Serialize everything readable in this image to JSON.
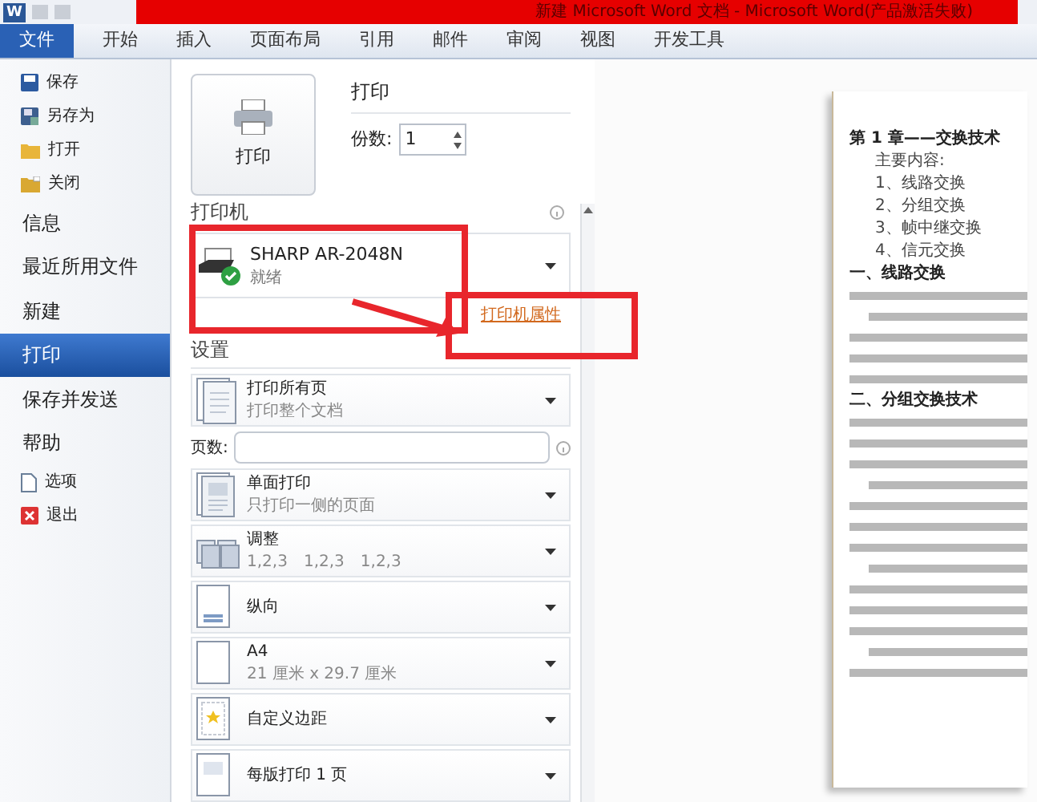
{
  "window": {
    "app_icon_letter": "W",
    "title": "新建 Microsoft Word 文档 - Microsoft Word(产品激活失败)"
  },
  "ribbon_tabs": [
    {
      "label": "文件",
      "selected": true
    },
    {
      "label": "开始",
      "selected": false
    },
    {
      "label": "插入",
      "selected": false
    },
    {
      "label": "页面布局",
      "selected": false
    },
    {
      "label": "引用",
      "selected": false
    },
    {
      "label": "邮件",
      "selected": false
    },
    {
      "label": "审阅",
      "selected": false
    },
    {
      "label": "视图",
      "selected": false
    },
    {
      "label": "开发工具",
      "selected": false
    }
  ],
  "sidebar": {
    "items": [
      {
        "label": "保存",
        "kind": "command",
        "selected": false
      },
      {
        "label": "另存为",
        "kind": "command",
        "selected": false
      },
      {
        "label": "打开",
        "kind": "command",
        "selected": false
      },
      {
        "label": "关闭",
        "kind": "command",
        "selected": false
      },
      {
        "label": "信息",
        "kind": "page",
        "selected": false
      },
      {
        "label": "最近所用文件",
        "kind": "page",
        "selected": false
      },
      {
        "label": "新建",
        "kind": "page",
        "selected": false
      },
      {
        "label": "打印",
        "kind": "page",
        "selected": true
      },
      {
        "label": "保存并发送",
        "kind": "page",
        "selected": false
      },
      {
        "label": "帮助",
        "kind": "page",
        "selected": false
      },
      {
        "label": "选项",
        "kind": "command",
        "selected": false
      },
      {
        "label": "退出",
        "kind": "command",
        "selected": false
      }
    ]
  },
  "print": {
    "button": "打印",
    "heading": "打印",
    "copies_label": "份数:",
    "copies_value": "1"
  },
  "printer": {
    "heading": "打印机",
    "name": "SHARP AR-2048N",
    "status": "就绪",
    "properties_link": "打印机属性"
  },
  "settings": {
    "heading": "设置",
    "items": [
      {
        "kind": "pages",
        "title": "打印所有页",
        "subtitle": "打印整个文档"
      },
      {
        "kind": "page_range",
        "label": "页数:"
      },
      {
        "kind": "duplex",
        "title": "单面打印",
        "subtitle": "只打印一侧的页面"
      },
      {
        "kind": "collate",
        "title": "调整",
        "subtitle_parts": [
          "1,2,3",
          "1,2,3",
          "1,2,3"
        ]
      },
      {
        "kind": "orientation",
        "title": "纵向"
      },
      {
        "kind": "paper",
        "title": "A4",
        "subtitle": "21 厘米 x 29.7 厘米"
      },
      {
        "kind": "margins",
        "title": "自定义边距"
      },
      {
        "kind": "per_sheet",
        "title": "每版打印 1 页"
      }
    ]
  },
  "preview": {
    "lines": [
      {
        "kind": "heading",
        "text": "第 1 章——交换技术"
      },
      {
        "kind": "indent",
        "text": "主要内容:"
      },
      {
        "kind": "indent",
        "text": "1、线路交换"
      },
      {
        "kind": "indent",
        "text": "2、分组交换"
      },
      {
        "kind": "indent",
        "text": "3、帧中继交换"
      },
      {
        "kind": "indent",
        "text": "4、信元交换"
      },
      {
        "kind": "heading",
        "text": "一、线路交换"
      },
      {
        "kind": "blur"
      },
      {
        "kind": "blur"
      },
      {
        "kind": "blur"
      },
      {
        "kind": "blur"
      },
      {
        "kind": "blur"
      },
      {
        "kind": "heading",
        "text": "二、分组交换技术"
      },
      {
        "kind": "blur"
      },
      {
        "kind": "blur"
      },
      {
        "kind": "blur"
      },
      {
        "kind": "blur"
      },
      {
        "kind": "blur"
      },
      {
        "kind": "blur"
      },
      {
        "kind": "blur"
      },
      {
        "kind": "blur"
      },
      {
        "kind": "blur"
      },
      {
        "kind": "blur"
      },
      {
        "kind": "blur"
      },
      {
        "kind": "blur"
      },
      {
        "kind": "blur"
      }
    ]
  }
}
